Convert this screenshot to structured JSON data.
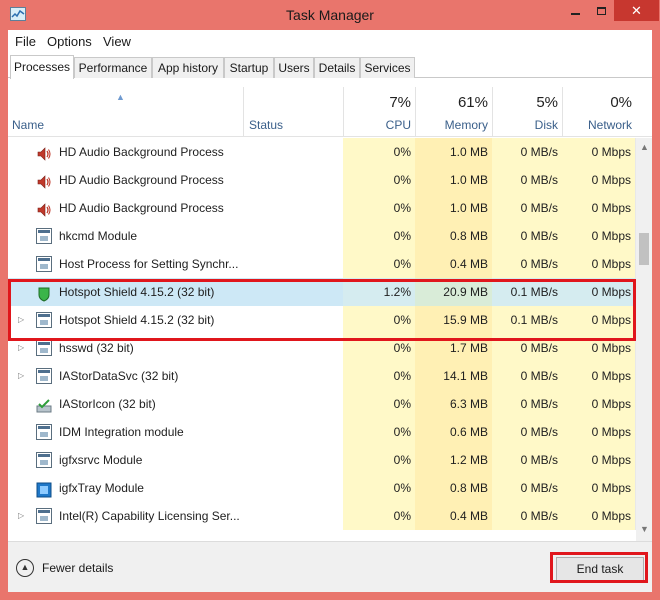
{
  "window": {
    "title": "Task Manager"
  },
  "menu": [
    "File",
    "Options",
    "View"
  ],
  "tabs": [
    "Processes",
    "Performance",
    "App history",
    "Startup",
    "Users",
    "Details",
    "Services"
  ],
  "active_tab": "Processes",
  "columns": {
    "name": "Name",
    "status": "Status",
    "cpu": {
      "label": "CPU",
      "total": "7%"
    },
    "memory": {
      "label": "Memory",
      "total": "61%"
    },
    "disk": {
      "label": "Disk",
      "total": "5%"
    },
    "network": {
      "label": "Network",
      "total": "0%"
    }
  },
  "processes": [
    {
      "name": "HD Audio Background Process",
      "icon": "speaker-icon",
      "expandable": false,
      "cpu": "0%",
      "memory": "1.0 MB",
      "disk": "0 MB/s",
      "network": "0 Mbps"
    },
    {
      "name": "HD Audio Background Process",
      "icon": "speaker-icon",
      "expandable": false,
      "cpu": "0%",
      "memory": "1.0 MB",
      "disk": "0 MB/s",
      "network": "0 Mbps"
    },
    {
      "name": "HD Audio Background Process",
      "icon": "speaker-icon",
      "expandable": false,
      "cpu": "0%",
      "memory": "1.0 MB",
      "disk": "0 MB/s",
      "network": "0 Mbps"
    },
    {
      "name": "hkcmd Module",
      "icon": "window-icon",
      "expandable": false,
      "cpu": "0%",
      "memory": "0.8 MB",
      "disk": "0 MB/s",
      "network": "0 Mbps"
    },
    {
      "name": "Host Process for Setting Synchr...",
      "icon": "window-icon",
      "expandable": false,
      "cpu": "0%",
      "memory": "0.4 MB",
      "disk": "0 MB/s",
      "network": "0 Mbps"
    },
    {
      "name": "Hotspot Shield 4.15.2 (32 bit)",
      "icon": "shield-icon",
      "expandable": false,
      "selected": true,
      "cpu": "1.2%",
      "memory": "20.9 MB",
      "disk": "0.1 MB/s",
      "network": "0 Mbps"
    },
    {
      "name": "Hotspot Shield 4.15.2 (32 bit)",
      "icon": "window-icon",
      "expandable": true,
      "cpu": "0%",
      "memory": "15.9 MB",
      "disk": "0.1 MB/s",
      "network": "0 Mbps"
    },
    {
      "name": "hsswd (32 bit)",
      "icon": "window-icon",
      "expandable": true,
      "cpu": "0%",
      "memory": "1.7 MB",
      "disk": "0 MB/s",
      "network": "0 Mbps"
    },
    {
      "name": "IAStorDataSvc (32 bit)",
      "icon": "window-icon",
      "expandable": true,
      "cpu": "0%",
      "memory": "14.1 MB",
      "disk": "0 MB/s",
      "network": "0 Mbps"
    },
    {
      "name": "IAStorIcon (32 bit)",
      "icon": "check-drive-icon",
      "expandable": false,
      "cpu": "0%",
      "memory": "6.3 MB",
      "disk": "0 MB/s",
      "network": "0 Mbps"
    },
    {
      "name": "IDM Integration module",
      "icon": "window-icon",
      "expandable": false,
      "cpu": "0%",
      "memory": "0.6 MB",
      "disk": "0 MB/s",
      "network": "0 Mbps"
    },
    {
      "name": "igfxsrvc Module",
      "icon": "window-icon",
      "expandable": false,
      "cpu": "0%",
      "memory": "1.2 MB",
      "disk": "0 MB/s",
      "network": "0 Mbps"
    },
    {
      "name": "igfxTray Module",
      "icon": "intel-graphics-icon",
      "expandable": false,
      "cpu": "0%",
      "memory": "0.8 MB",
      "disk": "0 MB/s",
      "network": "0 Mbps"
    },
    {
      "name": "Intel(R) Capability Licensing Ser...",
      "icon": "window-icon",
      "expandable": true,
      "cpu": "0%",
      "memory": "0.4 MB",
      "disk": "0 MB/s",
      "network": "0 Mbps"
    }
  ],
  "footer": {
    "fewer_details": "Fewer details",
    "end_task": "End task"
  },
  "colors": {
    "titlebar": "#e9756c",
    "highlight": "#e0161c",
    "cpu_heat": "#fff9c8",
    "memory_heat": "#fff0b4",
    "selected_row": "#cde8f6"
  }
}
